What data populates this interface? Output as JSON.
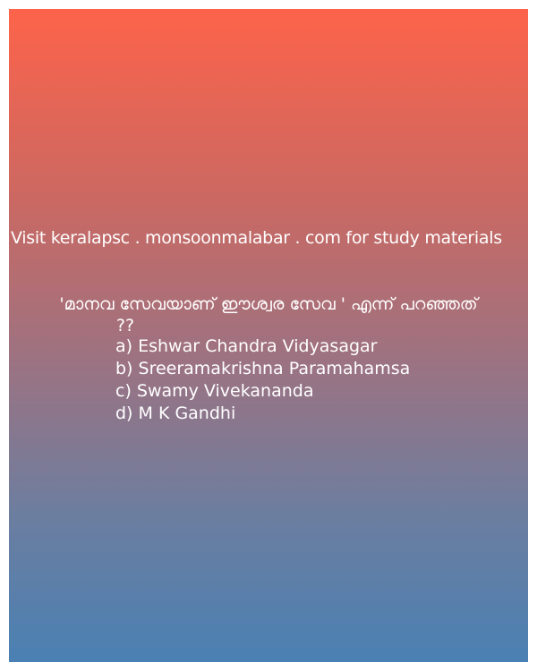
{
  "site_line": "Visit keralapsc . monsoonmalabar . com for study materials",
  "question": {
    "line1": "'മാനവ സേവയാണ് ഈശ്വര സേവ ' എന്ന് പറഞ്ഞത്",
    "line2": "??"
  },
  "options": [
    "a) Eshwar Chandra Vidyasagar",
    "b) Sreeramakrishna Paramahamsa",
    "c) Swamy Vivekananda",
    "d) M K Gandhi"
  ]
}
